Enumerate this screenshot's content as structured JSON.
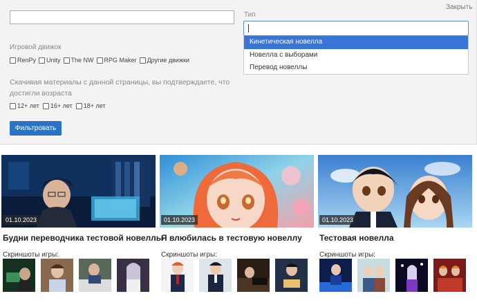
{
  "filters": {
    "close_label": "Закрыть",
    "name_input_value": "",
    "engine_label": "Игровой движок",
    "engines": [
      "RenPy",
      "Unity",
      "The NW",
      "RPG Maker",
      "Другие движки"
    ],
    "age_note": "Скачивая материалы с данной страницы, вы подтверждаете, что достигли возраста",
    "ages": [
      "12+ лет",
      "16+ лет",
      "18+ лет"
    ],
    "filter_button": "Фильтровать",
    "type_label": "Тип",
    "type_input_value": "",
    "type_options": [
      "Кинетическая новелла",
      "Новелла с выборами",
      "Перевод новеллы"
    ],
    "type_active": "Кинетическая новелла",
    "accent_color": "#2a73c4",
    "highlight_color": "#3875d7"
  },
  "novels": [
    {
      "title": "Будни переводчика тестовой новеллы",
      "date": "01.10.2023",
      "screenshots_label": "Скриншоты игры:"
    },
    {
      "title": "Я влюбилась в тестовую новеллу",
      "date": "01.10.2023",
      "screenshots_label": "Скриншоты игры:"
    },
    {
      "title": "Тестовая новелла",
      "date": "01.10.2023",
      "screenshots_label": "Скриншоты игры:"
    }
  ]
}
